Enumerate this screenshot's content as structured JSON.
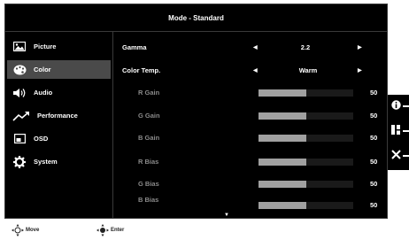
{
  "header": {
    "title": "Mode - Standard"
  },
  "sidebar": {
    "items": [
      {
        "label": "Picture",
        "icon": "picture-icon",
        "active": false
      },
      {
        "label": "Color",
        "icon": "palette-icon",
        "active": true
      },
      {
        "label": "Audio",
        "icon": "speaker-icon",
        "active": false
      },
      {
        "label": "Performance",
        "icon": "trend-icon",
        "active": false
      },
      {
        "label": "OSD",
        "icon": "osd-window-icon",
        "active": false
      },
      {
        "label": "System",
        "icon": "gear-icon",
        "active": false
      }
    ]
  },
  "settings": {
    "gamma": {
      "label": "Gamma",
      "value": "2.2"
    },
    "color_temp": {
      "label": "Color Temp.",
      "value": "Warm"
    },
    "sliders": [
      {
        "label": "R Gain",
        "value": "50",
        "level": 0.5
      },
      {
        "label": "G Gain",
        "value": "50",
        "level": 0.5
      },
      {
        "label": "B Gain",
        "value": "50",
        "level": 0.5
      },
      {
        "label": "R Bias",
        "value": "50",
        "level": 0.5
      },
      {
        "label": "G Bias",
        "value": "50",
        "level": 0.5
      },
      {
        "label": "B Bias",
        "value": "50",
        "level": 0.5
      }
    ]
  },
  "footer": {
    "move_label": "Move",
    "enter_label": "Enter"
  },
  "side_buttons": {
    "icons": [
      "info-icon",
      "input-source-icon",
      "close-icon"
    ]
  },
  "colors": {
    "background": "#000000",
    "active_item": "#4a4a4a",
    "bar_fill": "#a0a0a0",
    "dim_text": "#8a8a8a"
  }
}
